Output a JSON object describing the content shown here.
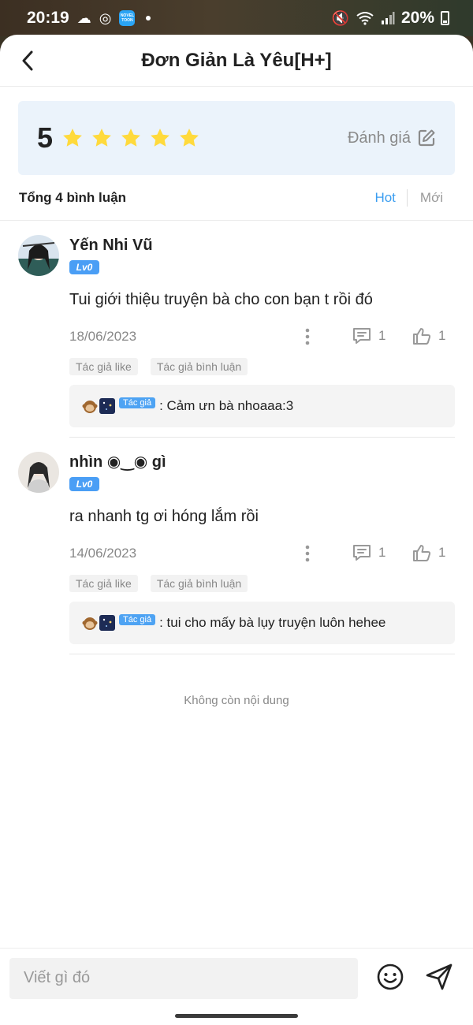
{
  "status_bar": {
    "time": "20:19",
    "novel_badge": "NOVEL TOON",
    "battery": "20%"
  },
  "header": {
    "title": "Đơn Giản Là Yêu[H+]"
  },
  "rating": {
    "score": "5",
    "stars_filled": 5,
    "stars_total": 5,
    "rate_label": "Đánh giá",
    "star_color": "#FFDA3C"
  },
  "list": {
    "total_label": "Tổng 4 bình luận",
    "sort_hot": "Hot",
    "sort_new": "Mới",
    "accent_color": "#3A9DF0"
  },
  "comments": [
    {
      "name": "Yến Nhi Vũ",
      "level": "Lv0",
      "body": "Tui giới thiệu truyện bà cho con bạn t rồi đó",
      "date": "18/06/2023",
      "reply_count": "1",
      "like_count": "1",
      "tags": [
        "Tác giả like",
        "Tác giả bình luận"
      ],
      "reply": {
        "author_badge": "Tác giả",
        "text": ": Cảm ưn bà nhoaaa:3"
      }
    },
    {
      "name": "nhìn ◉‿◉ gì",
      "level": "Lv0",
      "body": "ra nhanh tg ơi hóng lắm rồi",
      "date": "14/06/2023",
      "reply_count": "1",
      "like_count": "1",
      "tags": [
        "Tác giả like",
        "Tác giả bình luận"
      ],
      "reply": {
        "author_badge": "Tác giả",
        "text": ": tui cho mấy bà lụy truyện luôn hehee"
      }
    }
  ],
  "end_text": "Không còn nội dung",
  "composer": {
    "placeholder": "Viết gì đó",
    "value": ""
  }
}
